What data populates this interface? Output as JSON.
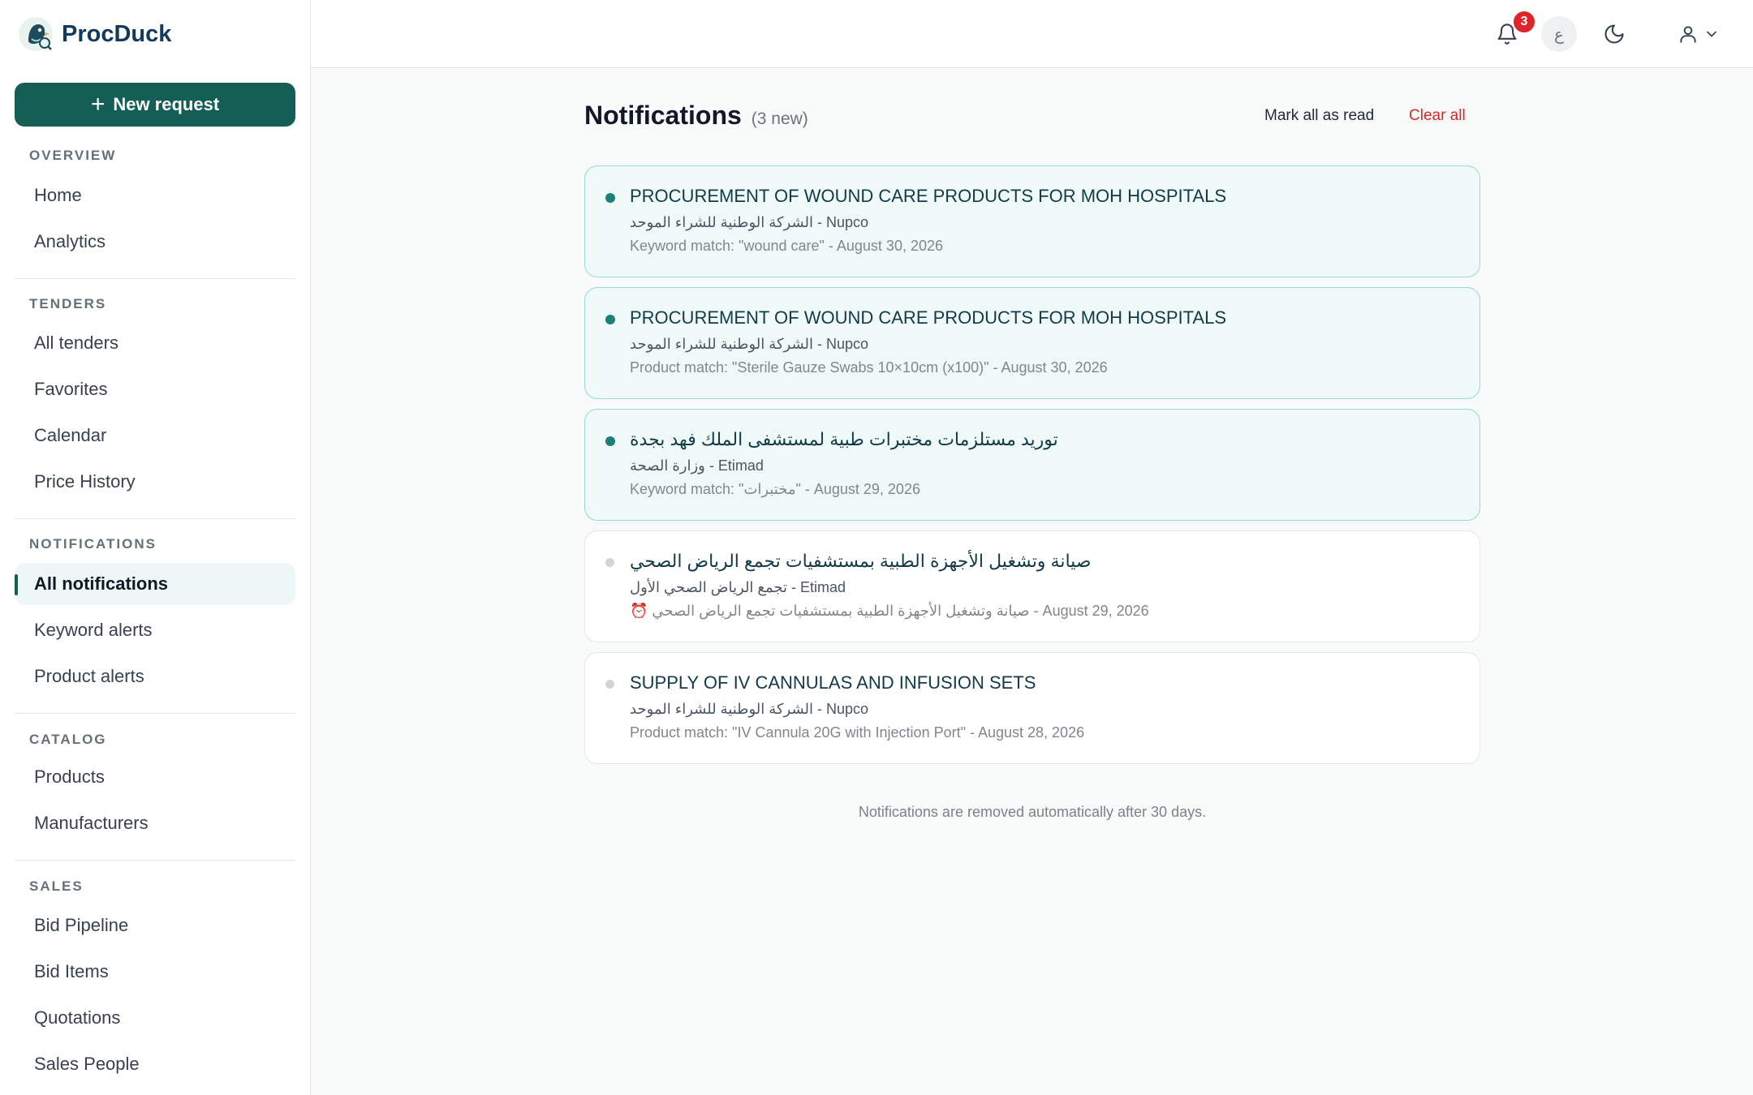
{
  "app": {
    "name": "ProcDuck"
  },
  "sidebar": {
    "new_request_label": "New request",
    "sections": {
      "overview": {
        "label": "OVERVIEW",
        "items": [
          "Home",
          "Analytics"
        ]
      },
      "tenders": {
        "label": "TENDERS",
        "items": [
          "All tenders",
          "Favorites",
          "Calendar",
          "Price History"
        ]
      },
      "notifications": {
        "label": "NOTIFICATIONS",
        "items": [
          "All notifications",
          "Keyword alerts",
          "Product alerts"
        ]
      },
      "catalog": {
        "label": "CATALOG",
        "items": [
          "Products",
          "Manufacturers"
        ]
      },
      "sales": {
        "label": "SALES",
        "items": [
          "Bid Pipeline",
          "Bid Items",
          "Quotations",
          "Sales People"
        ]
      }
    },
    "active_item": "All notifications"
  },
  "topbar": {
    "notification_count": "3",
    "language_toggle": "ع",
    "icons": [
      "bell-icon",
      "moon-icon",
      "user-icon",
      "chevron-down-icon"
    ]
  },
  "page": {
    "title": "Notifications",
    "new_count": "(3 new)",
    "mark_all_read": "Mark all as read",
    "clear_all": "Clear all",
    "footnote": "Notifications are removed automatically after 30 days."
  },
  "notifications": [
    {
      "title": "PROCUREMENT OF WOUND CARE PRODUCTS FOR MOH HOSPITALS",
      "source": "الشركة الوطنية للشراء الموحد - Nupco",
      "meta": "Keyword match: \"wound care\" - August 30, 2026",
      "unread": true
    },
    {
      "title": "PROCUREMENT OF WOUND CARE PRODUCTS FOR MOH HOSPITALS",
      "source": "الشركة الوطنية للشراء الموحد - Nupco",
      "meta": "Product match: \"Sterile Gauze Swabs 10×10cm (x100)\" - August 30, 2026",
      "unread": true
    },
    {
      "title": "توريد مستلزمات مختبرات طبية لمستشفى الملك فهد بجدة",
      "source": "وزارة الصحة - Etimad",
      "meta": "Keyword match: \"مختبرات\" - August 29, 2026",
      "unread": true
    },
    {
      "title": "صيانة وتشغيل الأجهزة الطبية بمستشفيات تجمع الرياض الصحي",
      "source": "تجمع الرياض الصحي الأول - Etimad",
      "meta": "⏰ صيانة وتشغيل الأجهزة الطبية بمستشفيات تجمع الرياض الصحي - August 29, 2026",
      "unread": false
    },
    {
      "title": "SUPPLY OF IV CANNULAS AND INFUSION SETS",
      "source": "الشركة الوطنية للشراء الموحد - Nupco",
      "meta": "Product match: \"IV Cannula 20G with Injection Port\" - August 28, 2026",
      "unread": false
    }
  ],
  "colors": {
    "brand": "#155e56",
    "unread_bg": "#effaf8",
    "unread_border": "#9ad8d0",
    "danger": "#dc2626"
  }
}
